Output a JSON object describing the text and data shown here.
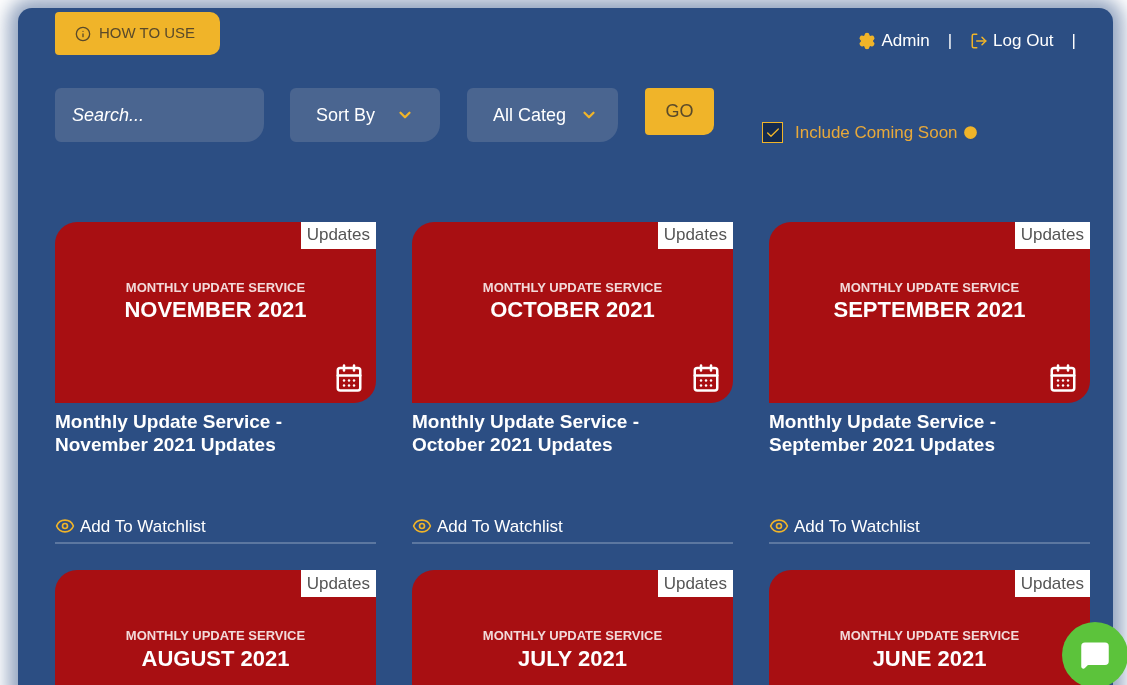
{
  "header": {
    "how_to_use": "HOW TO USE",
    "admin": "Admin",
    "separator_1": "|",
    "logout": "Log Out",
    "separator_2": "|"
  },
  "filters": {
    "search": {
      "placeholder": "Search..."
    },
    "sort": {
      "value": "Sort By"
    },
    "category": {
      "value": "All Categ"
    },
    "go": "GO",
    "coming_soon": {
      "label": "Include Coming Soon",
      "checked": true
    }
  },
  "cards": [
    {
      "category": "Updates",
      "banner_top": "MONTHLY UPDATE SERVICE",
      "banner_main": "NOVEMBER 2021",
      "title": "Monthly Update Service - November 2021 Updates",
      "watchlist": "Add To Watchlist"
    },
    {
      "category": "Updates",
      "banner_top": "MONTHLY UPDATE SERVICE",
      "banner_main": "OCTOBER 2021",
      "title": "Monthly Update Service - October 2021 Updates",
      "watchlist": "Add To Watchlist"
    },
    {
      "category": "Updates",
      "banner_top": "MONTHLY UPDATE SERVICE",
      "banner_main": "SEPTEMBER 2021",
      "title": "Monthly Update Service - September 2021 Updates",
      "watchlist": "Add To Watchlist"
    },
    {
      "category": "Updates",
      "banner_top": "MONTHLY UPDATE SERVICE",
      "banner_main": "AUGUST 2021"
    },
    {
      "category": "Updates",
      "banner_top": "MONTHLY UPDATE SERVICE",
      "banner_main": "JULY 2021"
    },
    {
      "category": "Updates",
      "banner_top": "MONTHLY UPDATE SERVICE",
      "banner_main": "JUNE 2021"
    }
  ]
}
